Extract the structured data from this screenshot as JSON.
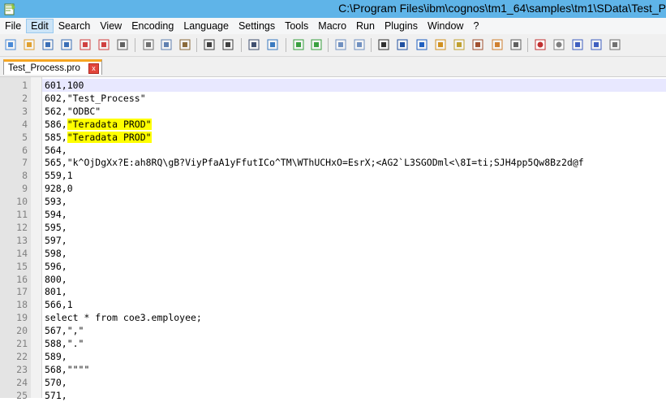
{
  "window": {
    "title": "C:\\Program Files\\ibm\\cognos\\tm1_64\\samples\\tm1\\SData\\Test_P"
  },
  "menu": [
    {
      "label": "File"
    },
    {
      "label": "Edit",
      "active": true
    },
    {
      "label": "Search"
    },
    {
      "label": "View"
    },
    {
      "label": "Encoding"
    },
    {
      "label": "Language"
    },
    {
      "label": "Settings"
    },
    {
      "label": "Tools"
    },
    {
      "label": "Macro"
    },
    {
      "label": "Run"
    },
    {
      "label": "Plugins"
    },
    {
      "label": "Window"
    },
    {
      "label": "?"
    }
  ],
  "toolbar": {
    "icons": [
      "new-file-icon",
      "open-file-icon",
      "save-icon",
      "save-all-icon",
      "close-icon",
      "close-all-icon",
      "print-icon",
      "cut-icon",
      "copy-icon",
      "paste-icon",
      "undo-icon",
      "redo-icon",
      "find-icon",
      "replace-icon",
      "zoom-in-icon",
      "zoom-out-icon",
      "sync-vertical-icon",
      "sync-horizontal-icon",
      "word-wrap-icon",
      "show-all-chars-icon",
      "indent-guide-icon",
      "user-language-icon",
      "doc-map-icon",
      "function-list-icon",
      "folder-workspace-icon",
      "monitor-icon",
      "record-macro-icon",
      "stop-record-icon",
      "play-macro-icon",
      "run-macro-multiple-icon",
      "save-macro-icon"
    ]
  },
  "tab": {
    "label": "Test_Process.pro",
    "close": "x"
  },
  "editor": {
    "lines": [
      {
        "num": "1",
        "pre": "601,100",
        "hl": "",
        "post": ""
      },
      {
        "num": "2",
        "pre": "602,\"Test_Process\"",
        "hl": "",
        "post": ""
      },
      {
        "num": "3",
        "pre": "562,\"ODBC\"",
        "hl": "",
        "post": ""
      },
      {
        "num": "4",
        "pre": "586,",
        "hl": "\"Teradata PROD\"",
        "post": ""
      },
      {
        "num": "5",
        "pre": "585,",
        "hl": "\"Teradata PROD\"",
        "post": ""
      },
      {
        "num": "6",
        "pre": "564,",
        "hl": "",
        "post": ""
      },
      {
        "num": "7",
        "pre": "565,\"k^OjDgXx?E:ah8RQ\\gB?ViyPfaA1yFfutICo^TM\\WThUCHxO=EsrX;<AG2`L3SGODml<\\8I=ti;SJH4pp5Qw8Bz2d@f",
        "hl": "",
        "post": ""
      },
      {
        "num": "8",
        "pre": "559,1",
        "hl": "",
        "post": ""
      },
      {
        "num": "9",
        "pre": "928,0",
        "hl": "",
        "post": ""
      },
      {
        "num": "10",
        "pre": "593,",
        "hl": "",
        "post": ""
      },
      {
        "num": "11",
        "pre": "594,",
        "hl": "",
        "post": ""
      },
      {
        "num": "12",
        "pre": "595,",
        "hl": "",
        "post": ""
      },
      {
        "num": "13",
        "pre": "597,",
        "hl": "",
        "post": ""
      },
      {
        "num": "14",
        "pre": "598,",
        "hl": "",
        "post": ""
      },
      {
        "num": "15",
        "pre": "596,",
        "hl": "",
        "post": ""
      },
      {
        "num": "16",
        "pre": "800,",
        "hl": "",
        "post": ""
      },
      {
        "num": "17",
        "pre": "801,",
        "hl": "",
        "post": ""
      },
      {
        "num": "18",
        "pre": "566,1",
        "hl": "",
        "post": ""
      },
      {
        "num": "19",
        "pre": "select * from coe3.employee;",
        "hl": "",
        "post": ""
      },
      {
        "num": "20",
        "pre": "567,\",\"",
        "hl": "",
        "post": ""
      },
      {
        "num": "21",
        "pre": "588,\".\"",
        "hl": "",
        "post": ""
      },
      {
        "num": "22",
        "pre": "589,",
        "hl": "",
        "post": ""
      },
      {
        "num": "23",
        "pre": "568,\"\"\"\"",
        "hl": "",
        "post": ""
      },
      {
        "num": "24",
        "pre": "570,",
        "hl": "",
        "post": ""
      },
      {
        "num": "25",
        "pre": "571,",
        "hl": "",
        "post": ""
      }
    ]
  },
  "colors": {
    "titlebar": "#5fb4e8",
    "highlight": "#ffff00",
    "current_line": "#e8e8ff",
    "line_numbers": "#808080"
  }
}
